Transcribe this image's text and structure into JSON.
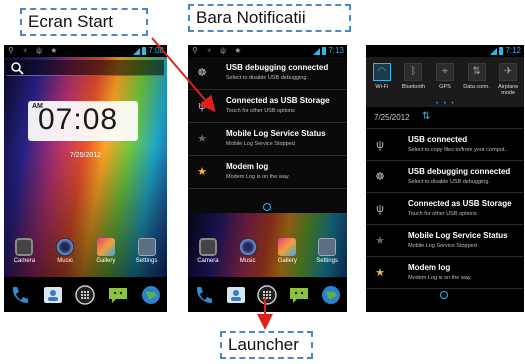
{
  "callouts": {
    "start": "Ecran Start",
    "notifications": "Bara Notificatii",
    "launcher": "Launcher"
  },
  "home": {
    "status_time": "7:08",
    "clock_ampm": "AM",
    "clock_time": "07:08",
    "date": "7/25/2012",
    "apps": [
      "Camera",
      "Music",
      "Gallery",
      "Settings"
    ]
  },
  "shade": {
    "status_time": "7:13",
    "notifications": [
      {
        "title": "USB debugging connected",
        "subtitle": "Select to disable USB debugging."
      },
      {
        "title": "Connected as USB Storage",
        "subtitle": "Touch for other USB options"
      },
      {
        "title": "Mobile Log Service Status",
        "subtitle": "Mobile Log Service Stopped"
      },
      {
        "title": "Modem log",
        "subtitle": "Modem Log is on the way."
      }
    ]
  },
  "expanded": {
    "status_time": "7:12",
    "quick_settings": [
      "Wi-Fi",
      "Bluetooth",
      "GPS",
      "Data conn.",
      "Airplane mode"
    ],
    "date": "7/25/2012",
    "notifications": [
      {
        "title": "USB connected",
        "subtitle": "Select to copy files to/from your comput..."
      },
      {
        "title": "USB debugging connected",
        "subtitle": "Select to disable USB debugging."
      },
      {
        "title": "Connected as USB Storage",
        "subtitle": "Touch for other USB options"
      },
      {
        "title": "Mobile Log Service Status",
        "subtitle": "Mobile Log Service Stopped"
      },
      {
        "title": "Modem log",
        "subtitle": "Modem Log is on the way."
      }
    ]
  },
  "colors": {
    "accent": "#33b5e5",
    "callout_border": "#4f86c6",
    "arrow": "#e0201b"
  }
}
